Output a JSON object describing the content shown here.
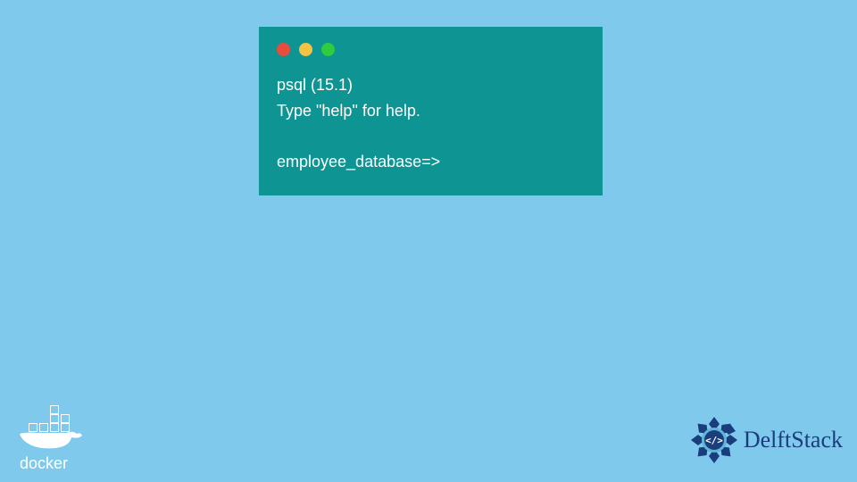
{
  "terminal": {
    "line1": "psql (15.1)",
    "line2": "Type \"help\" for help.",
    "prompt": "employee_database=>"
  },
  "logos": {
    "docker_label": "docker",
    "delftstack_label": "DelftStack"
  },
  "colors": {
    "background": "#7fc9ed",
    "terminal_bg": "#0f9494",
    "terminal_text": "#ffffff",
    "docker_color": "#ffffff",
    "delftstack_color": "#1a3d7c"
  }
}
